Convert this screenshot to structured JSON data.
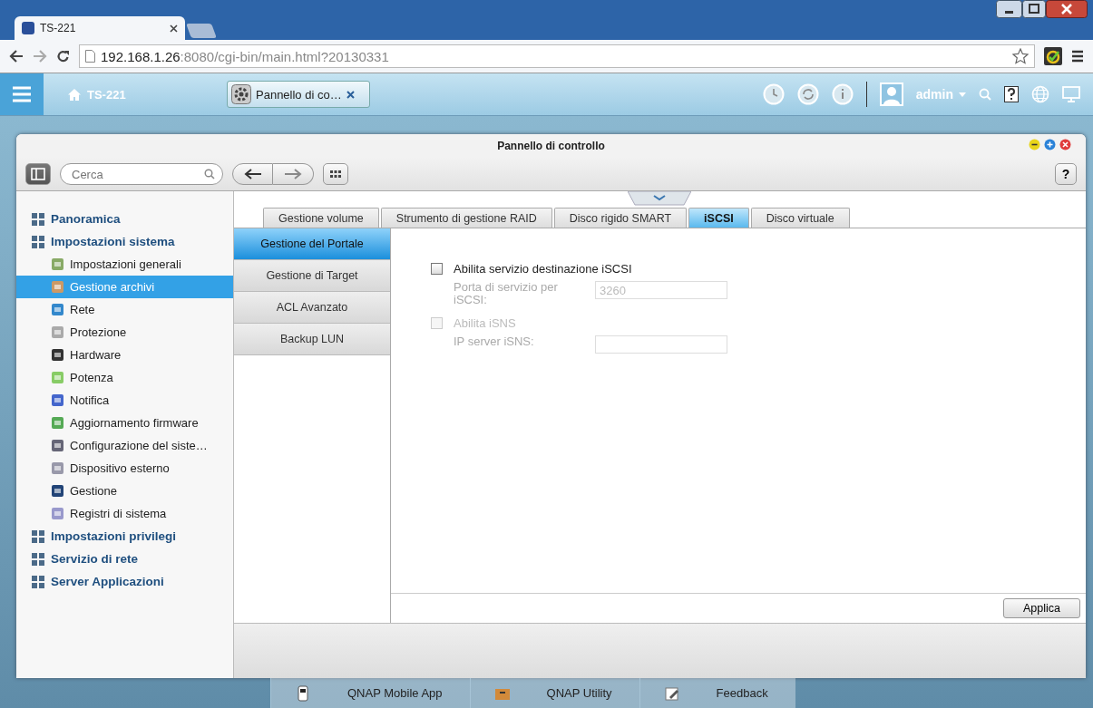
{
  "browser": {
    "tabs": [
      {
        "title": "TS-221",
        "selected": true
      }
    ],
    "address": {
      "host": "192.168.1.26",
      "path": ":8080/cgi-bin/main.html?20130331"
    }
  },
  "top_bar": {
    "home_label": "TS-221",
    "app_tab": "Pannello di co…",
    "user": "admin"
  },
  "window": {
    "title": "Pannello di controllo",
    "search": {
      "placeholder": "Cerca"
    },
    "help": "?"
  },
  "sidebar": {
    "items": [
      {
        "label": "Panoramica",
        "selected": false
      },
      {
        "label": "Impostazioni sistema",
        "selected": false,
        "children": [
          {
            "label": "Impostazioni generali",
            "selected": false
          },
          {
            "label": "Gestione archivi",
            "selected": true
          },
          {
            "label": "Rete",
            "selected": false
          },
          {
            "label": "Protezione",
            "selected": false
          },
          {
            "label": "Hardware",
            "selected": false
          },
          {
            "label": "Potenza",
            "selected": false
          },
          {
            "label": "Notifica",
            "selected": false
          },
          {
            "label": "Aggiornamento firmware",
            "selected": false
          },
          {
            "label": "Configurazione del siste…",
            "selected": false
          },
          {
            "label": "Dispositivo esterno",
            "selected": false
          },
          {
            "label": "Gestione",
            "selected": false
          },
          {
            "label": "Registri di sistema",
            "selected": false
          }
        ]
      },
      {
        "label": "Impostazioni privilegi",
        "selected": false
      },
      {
        "label": "Servizio di rete",
        "selected": false
      },
      {
        "label": "Server Applicazioni",
        "selected": false
      }
    ]
  },
  "tabs": [
    {
      "label": "Gestione volume",
      "selected": false
    },
    {
      "label": "Strumento di gestione RAID",
      "selected": false
    },
    {
      "label": "Disco rigido SMART",
      "selected": false
    },
    {
      "label": "iSCSI",
      "selected": true
    },
    {
      "label": "Disco virtuale",
      "selected": false
    }
  ],
  "subnav": [
    {
      "label": "Gestione del Portale",
      "selected": true
    },
    {
      "label": "Gestione di Target",
      "selected": false
    },
    {
      "label": "ACL Avanzato",
      "selected": false
    },
    {
      "label": "Backup LUN",
      "selected": false
    }
  ],
  "form": [
    {
      "kind": "checkbox",
      "label": "Abilita servizio destinazione iSCSI",
      "checked": false,
      "disabled": false
    },
    {
      "kind": "field",
      "label": "Porta di servizio per iSCSI:",
      "value": "3260",
      "disabled": true
    },
    {
      "kind": "checkbox",
      "label": "Abilita iSNS",
      "checked": false,
      "disabled": true
    },
    {
      "kind": "field",
      "label": "IP server iSNS:",
      "disabled": true
    }
  ],
  "apply_button": "Applica",
  "taskbar": [
    {
      "label": "QNAP Mobile App"
    },
    {
      "label": "QNAP Utility"
    },
    {
      "label": "Feedback"
    }
  ]
}
